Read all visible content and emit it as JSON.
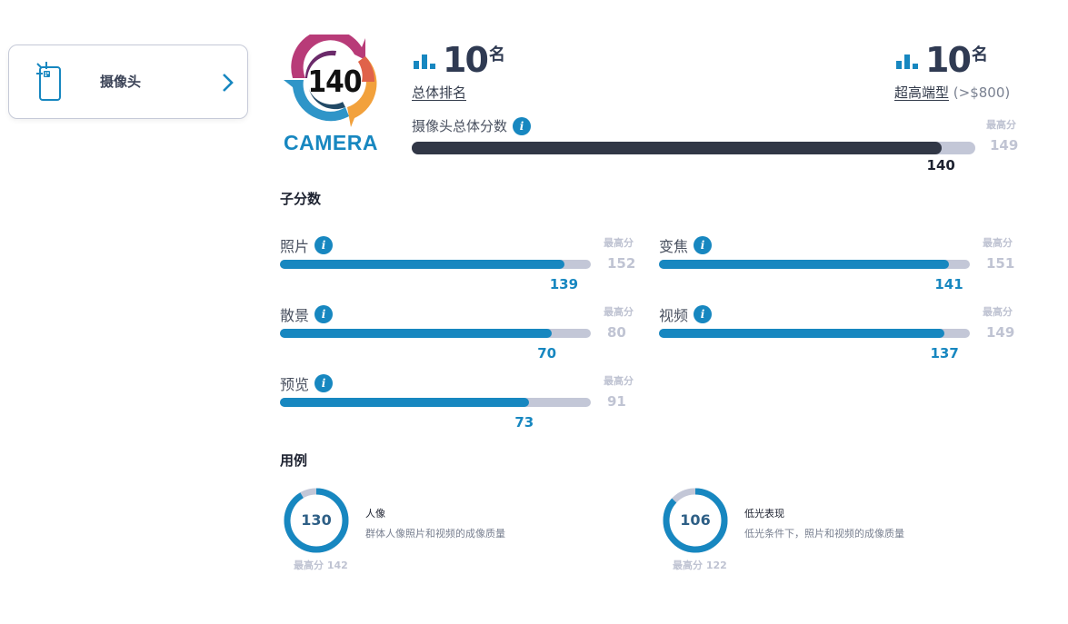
{
  "sidebar": {
    "card_label": "摄像头",
    "card_icon": "phone-camera-icon",
    "chevron_icon": "chevron-right-icon"
  },
  "badge": {
    "score": "140",
    "category": "CAMERA"
  },
  "rankings": [
    {
      "number": "10",
      "suffix": "名",
      "label": "总体排名",
      "extra": ""
    },
    {
      "number": "10",
      "suffix": "名",
      "label": "超高端型",
      "extra": "(>$800)"
    }
  ],
  "overall": {
    "title": "摄像头总体分数",
    "score": 140,
    "max": 149,
    "max_label": "最高分"
  },
  "subscores": {
    "title": "子分数",
    "max_label": "最高分",
    "items": [
      {
        "label": "照片",
        "score": 139,
        "max": 152
      },
      {
        "label": "变焦",
        "score": 141,
        "max": 151
      },
      {
        "label": "散景",
        "score": 70,
        "max": 80
      },
      {
        "label": "视频",
        "score": 137,
        "max": 149
      },
      {
        "label": "预览",
        "score": 73,
        "max": 91
      }
    ]
  },
  "use_cases": {
    "title": "用例",
    "items": [
      {
        "score": 130,
        "max": 142,
        "max_text": "最高分 142",
        "title": "人像",
        "desc": "群体人像照片和视频的成像质量"
      },
      {
        "score": 106,
        "max": 122,
        "max_text": "最高分 122",
        "title": "低光表现",
        "desc": "低光条件下，照片和视频的成像质量"
      }
    ]
  },
  "colors": {
    "accent": "#1787c0",
    "overall_fill": "#313746",
    "track": "#c3c7d7",
    "muted": "#bfc3d2"
  }
}
